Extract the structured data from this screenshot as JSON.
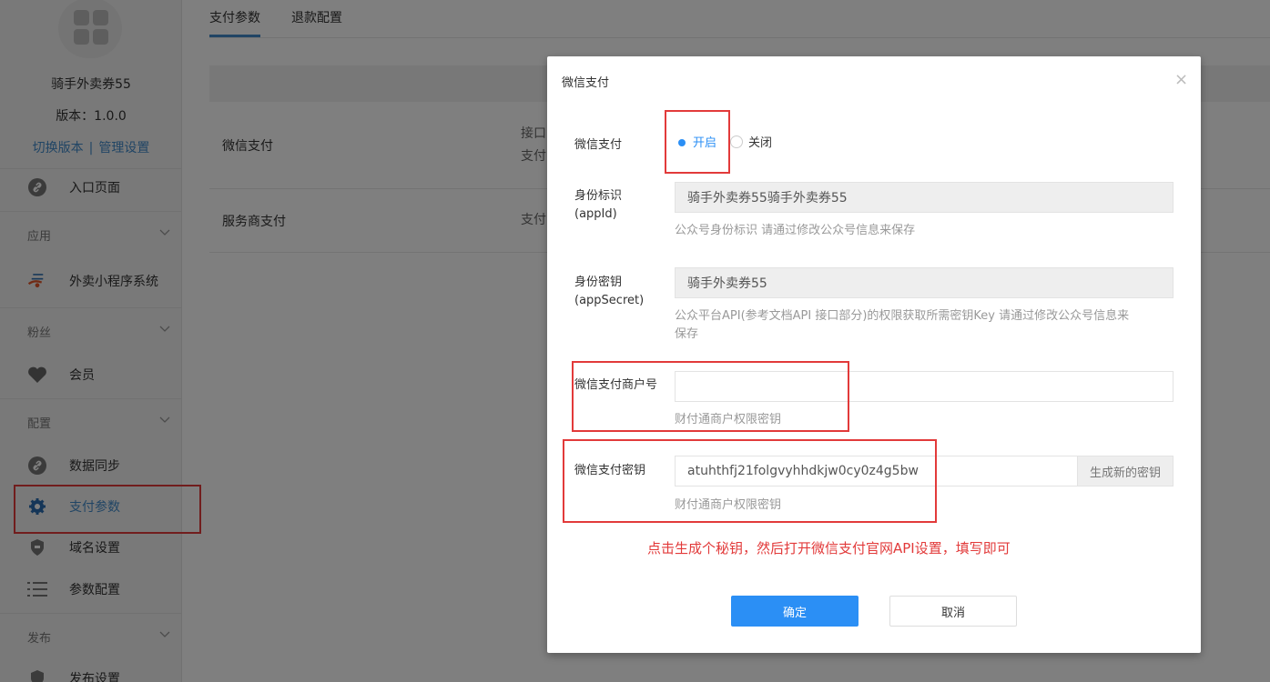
{
  "sidebar": {
    "app_name": "骑手外卖券55",
    "version": "版本：1.0.0",
    "links": {
      "switch_version": "切换版本",
      "separator": "|",
      "manage_settings": "管理设置"
    },
    "entry_page": "入口页面",
    "groups": [
      {
        "title": "应用",
        "items": [
          "外卖小程序系统"
        ]
      },
      {
        "title": "粉丝",
        "items": [
          "会员"
        ]
      },
      {
        "title": "配置",
        "items": [
          "数据同步",
          "支付参数",
          "域名设置",
          "参数配置"
        ]
      },
      {
        "title": "发布",
        "items": [
          "发布设置"
        ]
      }
    ],
    "active_item": "支付参数"
  },
  "tabs": [
    {
      "label": "支付参数",
      "active": true
    },
    {
      "label": "退款配置",
      "active": false
    }
  ],
  "table": {
    "rows": [
      {
        "name": "微信支付",
        "detail_lines": [
          "接口",
          "支付"
        ]
      },
      {
        "name": "服务商支付",
        "detail_lines": [
          "支付"
        ]
      }
    ]
  },
  "modal": {
    "title": "微信支付",
    "close_label": "×",
    "wechat_pay": {
      "label": "微信支付",
      "options": [
        {
          "label": "开启",
          "selected": true
        },
        {
          "label": "关闭",
          "selected": false
        }
      ]
    },
    "app_id": {
      "label_line1": "身份标识",
      "label_line2": "(appId)",
      "value": "骑手外卖券55骑手外卖券55",
      "help": "公众号身份标识 请通过修改公众号信息来保存"
    },
    "app_secret": {
      "label_line1": "身份密钥",
      "label_line2": "(appSecret)",
      "value": "骑手外卖券55",
      "help_line1": "公众平台API(参考文档API 接口部分)的权限获取所需密钥Key 请通过修改公众号信息来",
      "help_line2": "保存"
    },
    "merchant_id": {
      "label": "微信支付商户号",
      "value": "",
      "help": "财付通商户权限密钥"
    },
    "pay_key": {
      "label": "微信支付密钥",
      "value": "atuhthfj21folgvyhhdkjw0cy0z4g5bw",
      "generate_button": "生成新的密钥",
      "help": "财付通商户权限密钥"
    },
    "note": "点击生成个秘钥，然后打开微信支付官网API设置，填写即可",
    "confirm_button": "确定",
    "cancel_button": "取消"
  },
  "colors": {
    "primary": "#2b8ff5",
    "link": "#428bca",
    "annotation_red": "#e23a3a"
  }
}
